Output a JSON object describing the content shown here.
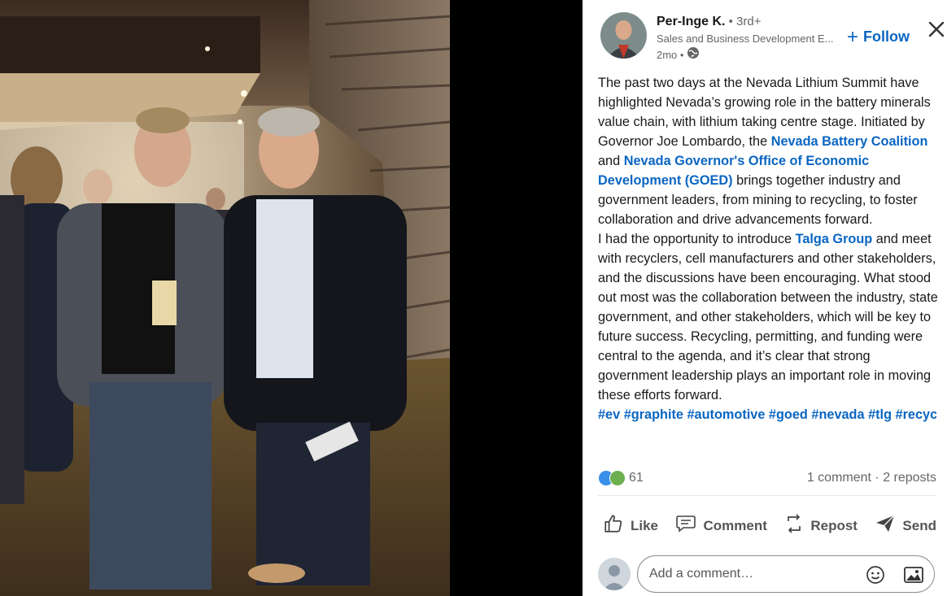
{
  "post": {
    "author": {
      "name": "Per-Inge K.",
      "degree": " • 3rd+",
      "headline": "Sales and Business Development E...",
      "time": "2mo •"
    },
    "follow_label": "Follow",
    "text": {
      "p1_a": "The past two days at the Nevada Lithium Summit have highlighted Nevada’s growing role in the battery minerals value chain, with lithium taking centre stage. Initiated by Governor Joe Lombardo, the ",
      "link1": "Nevada Battery Coalition",
      "and": " and ",
      "link2": "Nevada Governor's Office of Economic Development (GOED)",
      "p1_b": " brings together industry and government leaders, from mining to recycling, to foster collaboration and drive advancements forward.",
      "p2_a": "I had the opportunity to introduce ",
      "link3": "Talga Group",
      "p2_b": " and meet with recyclers, cell manufacturers and other stakeholders, and the discussions have been encouraging. What stood out most was the collaboration between the industry, state government, and other stakeholders, which will be key to future success. Recycling, permitting, and funding were central to the agenda, and it’s clear that strong government leadership plays an important role in moving these efforts forward.",
      "hashtags": "#ev #graphite #automotive #goed #nevada #tlg #recycling"
    },
    "reaction_count": "61",
    "comments_reposts": "1 comment · 2 reposts",
    "actions": {
      "like": "Like",
      "comment": "Comment",
      "repost": "Repost",
      "send": "Send"
    },
    "comment_placeholder": "Add a comment…"
  },
  "colors": {
    "link": "#0a66c2",
    "like_reaction": "#378fe9",
    "support_reaction": "#6dae4f"
  }
}
